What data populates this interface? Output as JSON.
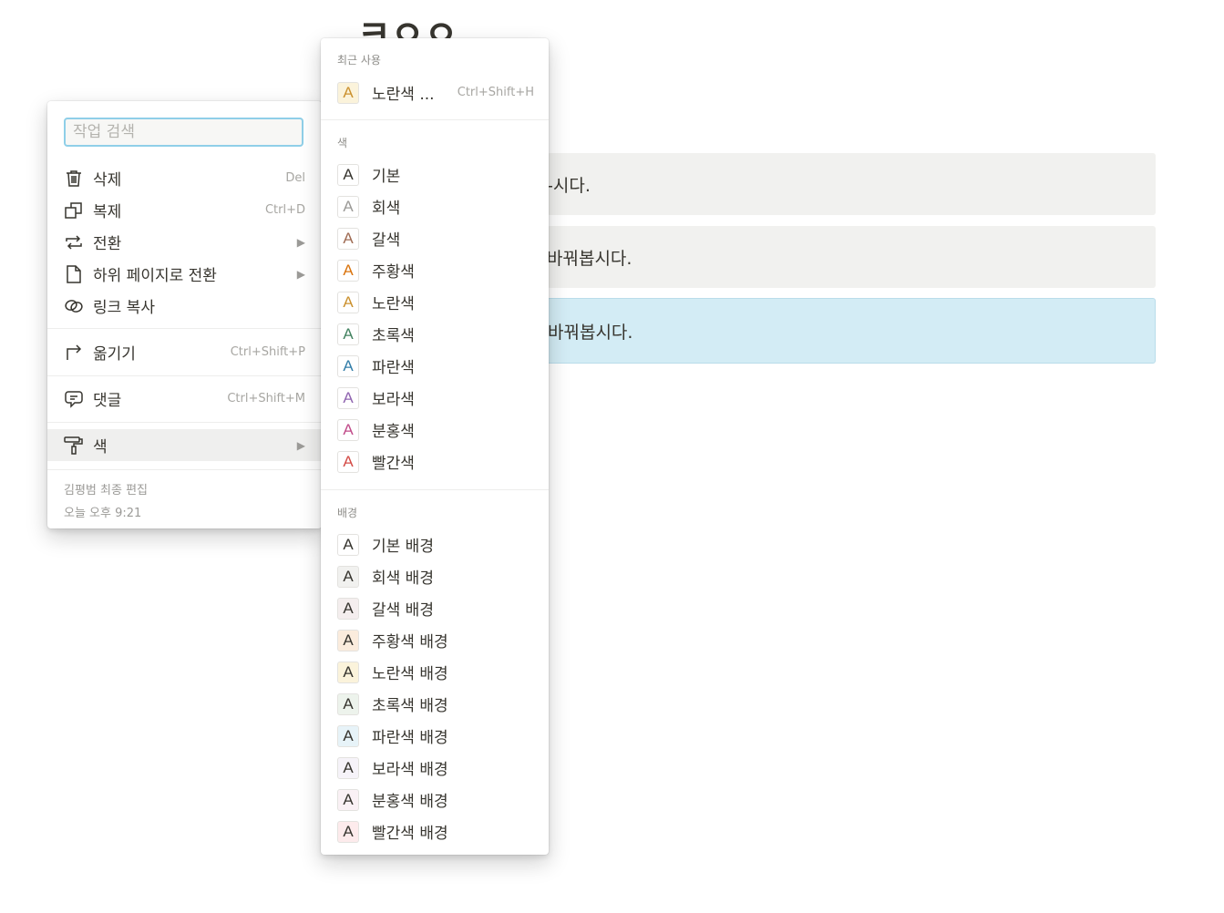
{
  "page": {
    "title_fragment": "ㅋㅇㅇ",
    "blocks": [
      {
        "text_fragment": "-시다."
      },
      {
        "text_fragment": "바꿔봅시다."
      },
      {
        "text_fragment": "바꿔봅시다."
      }
    ]
  },
  "action_menu": {
    "search_placeholder": "작업 검색",
    "items": [
      {
        "label": "삭제",
        "shortcut": "Del",
        "icon": "trash-icon"
      },
      {
        "label": "복제",
        "shortcut": "Ctrl+D",
        "icon": "duplicate-icon"
      },
      {
        "label": "전환",
        "arrow": "▶",
        "icon": "turn-into-icon"
      },
      {
        "label": "하위 페이지로 전환",
        "arrow": "▶",
        "icon": "page-icon"
      },
      {
        "label": "링크 복사",
        "icon": "link-icon"
      },
      {
        "label": "옮기기",
        "shortcut": "Ctrl+Shift+P",
        "icon": "move-icon"
      },
      {
        "label": "댓글",
        "shortcut": "Ctrl+Shift+M",
        "icon": "comment-icon"
      },
      {
        "label": "색",
        "arrow": "▶",
        "icon": "paint-roller-icon"
      }
    ],
    "edited_by": "김평범 최종 편집",
    "edited_time": "오늘 오후 9:21"
  },
  "color_menu": {
    "recent_title": "최근 사용",
    "recent": {
      "label": "노란색 ...",
      "shortcut": "Ctrl+Shift+H",
      "swatch_letter": "A",
      "color": "#cb912f",
      "bg": "#fbf3db"
    },
    "text_title": "색",
    "text_colors": [
      {
        "label": "기본",
        "color": "#37352f"
      },
      {
        "label": "회색",
        "color": "#9b9a97"
      },
      {
        "label": "갈색",
        "color": "#9f6b53"
      },
      {
        "label": "주황색",
        "color": "#d9730d"
      },
      {
        "label": "노란색",
        "color": "#cb912f"
      },
      {
        "label": "초록색",
        "color": "#448361"
      },
      {
        "label": "파란색",
        "color": "#337ea9"
      },
      {
        "label": "보라색",
        "color": "#9065b0"
      },
      {
        "label": "분홍색",
        "color": "#c14c8a"
      },
      {
        "label": "빨간색",
        "color": "#d44c47"
      }
    ],
    "bg_title": "배경",
    "bg_colors": [
      {
        "label": "기본 배경",
        "bg": "#ffffff"
      },
      {
        "label": "회색 배경",
        "bg": "#f1f1ef"
      },
      {
        "label": "갈색 배경",
        "bg": "#f4eeee"
      },
      {
        "label": "주황색 배경",
        "bg": "#fbecdd"
      },
      {
        "label": "노란색 배경",
        "bg": "#fbf3db"
      },
      {
        "label": "초록색 배경",
        "bg": "#edf3ec"
      },
      {
        "label": "파란색 배경",
        "bg": "#e7f3f8"
      },
      {
        "label": "보라색 배경",
        "bg": "#f6f3f9"
      },
      {
        "label": "분홍색 배경",
        "bg": "#faf1f5"
      },
      {
        "label": "빨간색 배경",
        "bg": "#fdebec"
      }
    ],
    "swatch_letter": "A"
  }
}
